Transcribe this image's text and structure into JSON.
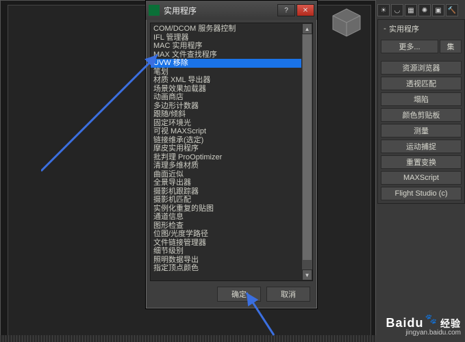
{
  "dialog": {
    "title": "实用程序",
    "items": [
      "COM/DCOM 服务器控制",
      "IFL 管理器",
      "MAC 实用程序",
      "MAX 文件查找程序",
      "UVW 移除",
      "笔划",
      "材质 XML 导出器",
      "场景效果加载器",
      "动画商店",
      "多边形计数器",
      "跟随/倾斜",
      "固定环境光",
      "可视 MAXScript",
      "链接维承(选定)",
      "摩皮实用程序",
      "批判理 ProOptimizer",
      "清理多维材质",
      "曲面近似",
      "全景导出器",
      "摄影机跟踪器",
      "摄影机匹配",
      "实例化重复的贴图",
      "通道信息",
      "图形检查",
      "位图/光度学路径",
      "文件链接管理器",
      "细节级别",
      "照明数据导出",
      "指定顶点颜色"
    ],
    "selected_index": 4,
    "ok_label": "确定",
    "cancel_label": "取消"
  },
  "side_panel": {
    "title": "实用程序",
    "more": "更多...",
    "set": "集",
    "buttons": [
      "资源浏览器",
      "透视匹配",
      "塌陷",
      "颜色剪贴板",
      "测量",
      "运动捕捉",
      "重置变换",
      "MAXScript",
      "Flight Studio (c)"
    ]
  },
  "top_icons": [
    "sun-icon",
    "arc-icon",
    "grid-icon",
    "globe-icon",
    "camera-icon",
    "hammer-icon"
  ],
  "watermark": {
    "brand": "Baidu",
    "suffix": "经验",
    "url": "jingyan.baidu.com"
  }
}
